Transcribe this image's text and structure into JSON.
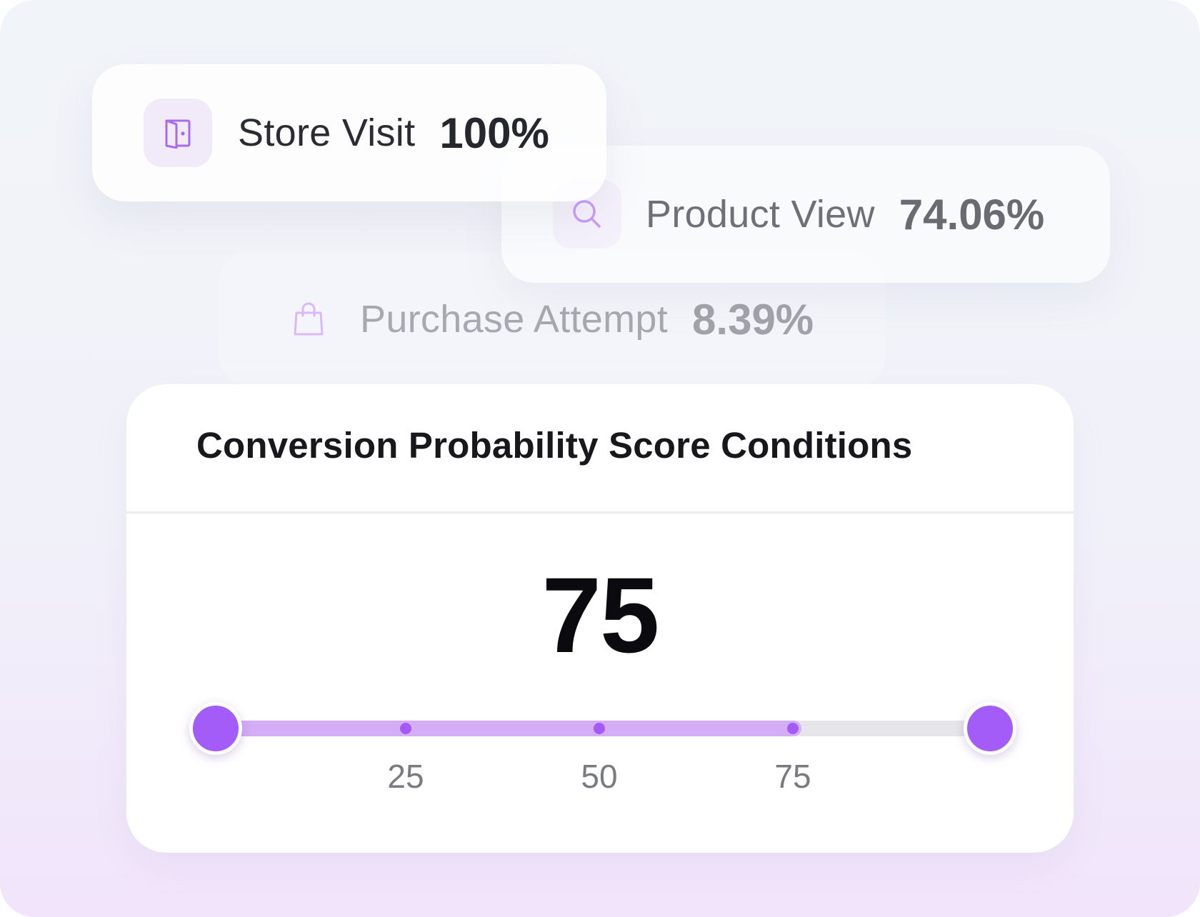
{
  "funnel": [
    {
      "label": "Store Visit",
      "value": "100%",
      "icon": "door-icon",
      "emphasis": "strong"
    },
    {
      "label": "Product View",
      "value": "74.06%",
      "icon": "search-icon",
      "emphasis": "medium"
    },
    {
      "label": "Purchase Attempt",
      "value": "8.39%",
      "icon": "shopping-bag-icon",
      "emphasis": "faded"
    }
  ],
  "score_card": {
    "title": "Conversion Probability Score Conditions",
    "score": "75",
    "slider": {
      "min": 0,
      "max": 100,
      "value": 75,
      "range": [
        0,
        100
      ],
      "ticks": [
        25,
        50,
        75
      ],
      "tick_labels": [
        "25",
        "50",
        "75"
      ]
    }
  },
  "colors": {
    "accent": "#a35cf8",
    "track_fill": "#d3aef6",
    "track_empty": "#e6e6ea",
    "icon_bg": "#f1eaf9"
  }
}
